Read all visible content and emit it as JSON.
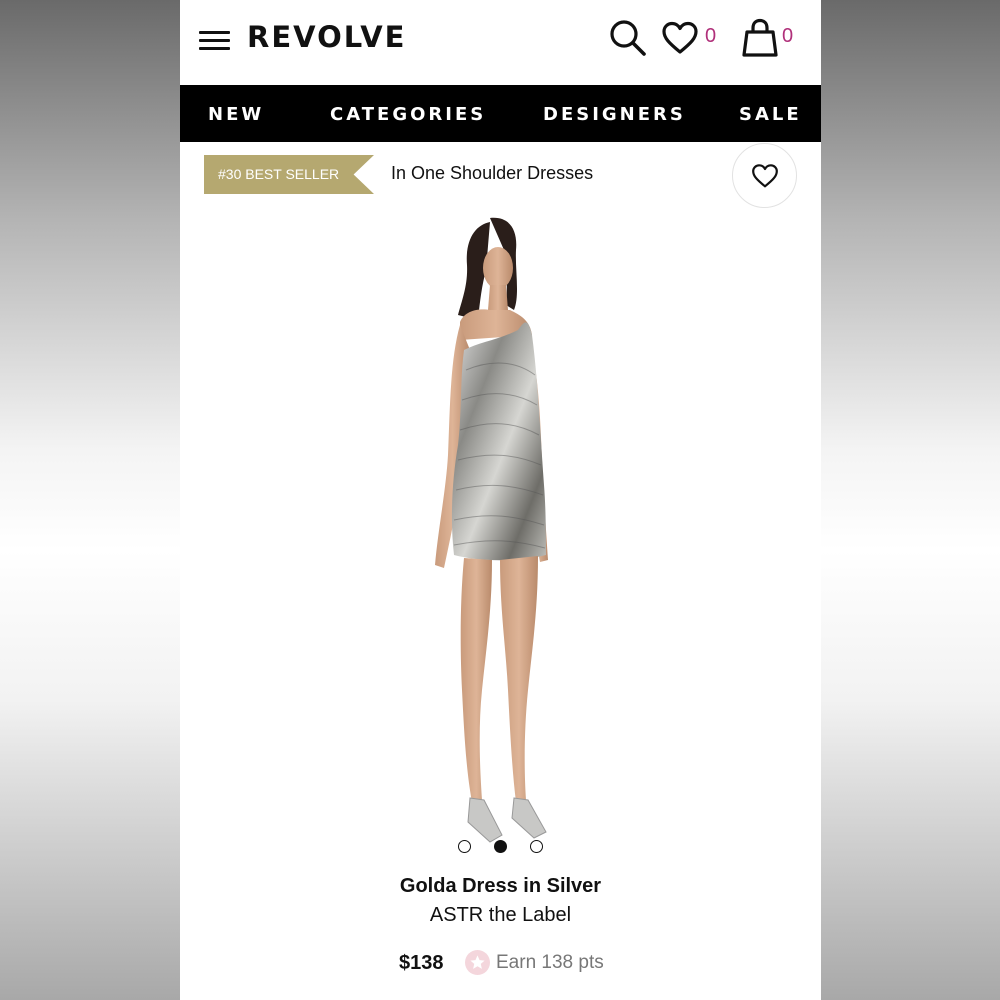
{
  "header": {
    "logo": "REVOLVE",
    "wishlist_count": "0",
    "bag_count": "0"
  },
  "nav": {
    "items": [
      "NEW",
      "CATEGORIES",
      "DESIGNERS",
      "SALE"
    ]
  },
  "badge": {
    "label": "#30 BEST SELLER",
    "caption": "In One Shoulder Dresses"
  },
  "carousel": {
    "total": 3,
    "active_index": 1
  },
  "product": {
    "name": "Golda Dress in Silver",
    "brand": "ASTR the Label",
    "price": "$138",
    "points": "Earn 138 pts"
  },
  "colors": {
    "badge": "#b5a870",
    "count": "#b0307a",
    "nav_bg": "#000000"
  },
  "icons": [
    "menu-icon",
    "search-icon",
    "heart-icon",
    "shopping-bag-icon",
    "star-icon"
  ]
}
